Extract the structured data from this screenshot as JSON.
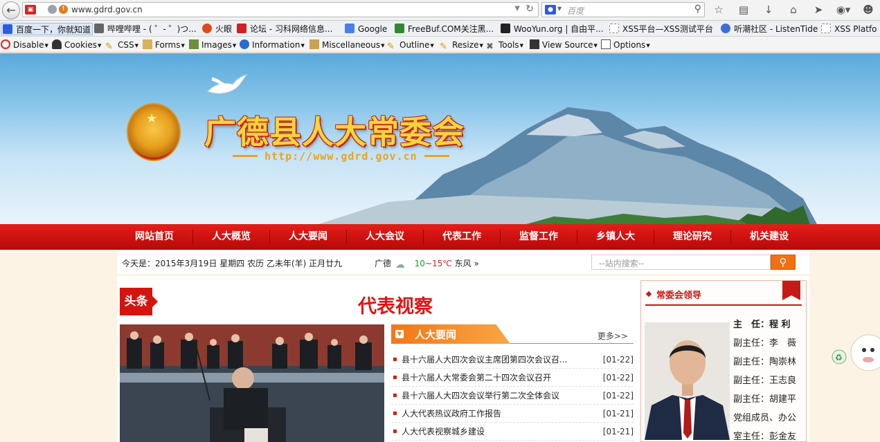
{
  "browser": {
    "url": "www.gdrd.gov.cn",
    "search_placeholder": "百度",
    "bookmarks": [
      {
        "label": "百度一下，你就知道",
        "icon": "baidu-paw-icon",
        "color": "#2b5ce6"
      },
      {
        "label": "哔哩哔哩 - ( ゜- ゜)つ...",
        "icon": "bilibili-tv-icon",
        "color": "#666666"
      },
      {
        "label": "火眼",
        "icon": "fire-eye-icon",
        "color": "#e04a1b"
      },
      {
        "label": "论坛 - 习科网络信息...",
        "icon": "silic-icon",
        "color": "#d02020"
      },
      {
        "label": "Google",
        "icon": "google-icon",
        "color": "#4a7fe8"
      },
      {
        "label": "FreeBuf.COM关注黑...",
        "icon": "freebuf-icon",
        "color": "#2f8a2f"
      },
      {
        "label": "WooYun.org | 自由平...",
        "icon": "wooyun-icon",
        "color": "#222222"
      },
      {
        "label": "XSS平台—XSS测试平台",
        "icon": "page-icon",
        "color": "#ffffff"
      },
      {
        "label": "听潮社区 - ListenTide",
        "icon": "listentide-icon",
        "color": "#3a6fd8"
      },
      {
        "label": "XSS Platfo",
        "icon": "page-icon",
        "color": "#ffffff"
      }
    ],
    "devtools": [
      "Disable",
      "Cookies",
      "CSS",
      "Forms",
      "Images",
      "Information",
      "Miscellaneous",
      "Outline",
      "Resize",
      "Tools",
      "View Source",
      "Options"
    ]
  },
  "site": {
    "title": "广德县人大常委会",
    "url_text": "http://www.gdrd.gov.cn"
  },
  "nav": [
    "网站首页",
    "人大概览",
    "人大要闻",
    "人大会议",
    "代表工作",
    "监督工作",
    "乡镇人大",
    "理论研究",
    "机关建设"
  ],
  "info": {
    "date": "今天是：2015年3月19日 星期四 农历 乙未年(羊) 正月廿九",
    "city": "广德",
    "temp_low": "10",
    "temp_high": "~15℃",
    "wind": "东风",
    "search_placeholder": "--站内搜索--"
  },
  "headline": {
    "badge": "头条",
    "title": "代表视察"
  },
  "news": {
    "title": "人大要闻",
    "more": "更多>>",
    "items": [
      {
        "title": "县十六届人大四次会议主席团第四次会议召...",
        "date": "[01-22]"
      },
      {
        "title": "县十六届人大常委会第二十四次会议召开",
        "date": "[01-22]"
      },
      {
        "title": "县十六届人大四次会议举行第二次全体会议",
        "date": "[01-22]"
      },
      {
        "title": "人大代表热议政府工作报告",
        "date": "[01-21]"
      },
      {
        "title": "人大代表视察城乡建设",
        "date": "[01-21]"
      }
    ]
  },
  "leaders": {
    "title": "常委会领导",
    "roster": [
      "主　任：程 利",
      "副主任：李　薇",
      "副主任：陶崇林",
      "副主任：王志良",
      "副主任：胡建平",
      "党组成员、办公",
      "室主任：彭金友"
    ]
  },
  "colors": {
    "nav_red": "#d6140f",
    "accent_orange": "#f47715",
    "headline_red": "#e11414"
  }
}
